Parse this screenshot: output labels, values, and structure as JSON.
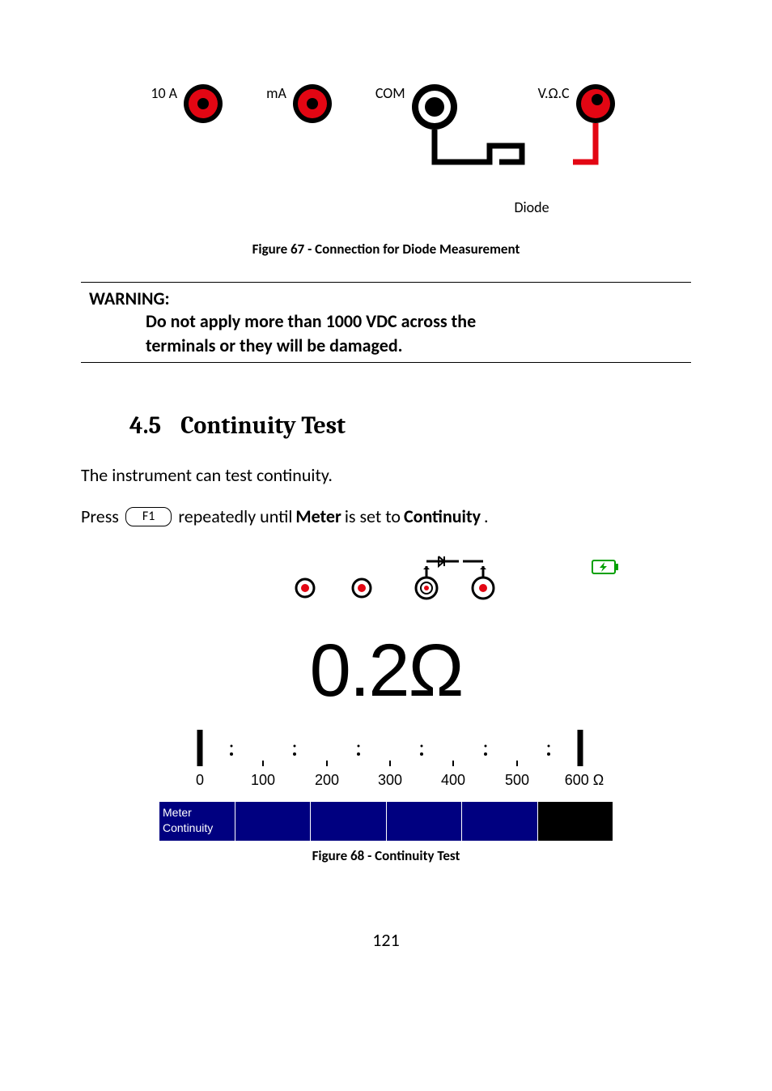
{
  "terminals": {
    "t10a": "10 A",
    "ma": "mA",
    "com": "COM",
    "voc": "V.Ω.C"
  },
  "diode_label": "Diode",
  "fig67_caption": "Figure 67 - Connection for Diode Measurement",
  "warning": {
    "title": "WARNING:",
    "line1": "Do not apply more than 1000 VDC across the",
    "line2": "terminals or they will be damaged."
  },
  "section": {
    "number": "4.5",
    "title": "Continuity Test"
  },
  "body": {
    "intro": "The instrument can test continuity.",
    "press_before": "Press",
    "f1_label": "F1",
    "press_after1": "repeatedly until ",
    "meter_bold": "Meter",
    "press_after2": " is set to ",
    "continuity_bold": "Continuity",
    "period": "."
  },
  "chart_data": {
    "type": "bar",
    "scale_ticks": [
      "0",
      "100",
      "200",
      "300",
      "400",
      "500",
      "600 Ω"
    ],
    "reading_value": "0.2",
    "reading_unit": "Ω",
    "indicator_value": 0.2,
    "range_max": 600
  },
  "softkeys": {
    "key1_line1": "Meter",
    "key1_line2": "Continuity"
  },
  "fig68_caption": "Figure 68 - Continuity Test",
  "page_number": "121"
}
